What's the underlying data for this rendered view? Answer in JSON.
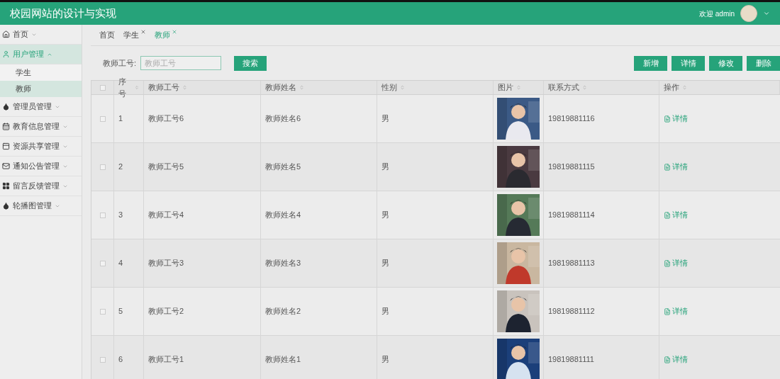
{
  "header": {
    "title": "校园网站的设计与实现",
    "welcome": "欢迎 admin"
  },
  "sidebar": {
    "items": [
      {
        "label": "首页",
        "expanded": false,
        "selected": false
      },
      {
        "label": "用户管理",
        "expanded": true,
        "selected": true,
        "children": [
          {
            "label": "学生",
            "selected": false
          },
          {
            "label": "教师",
            "selected": true
          }
        ]
      },
      {
        "label": "管理员管理",
        "expanded": false,
        "selected": false
      },
      {
        "label": "教育信息管理",
        "expanded": false,
        "selected": false
      },
      {
        "label": "资源共享管理",
        "expanded": false,
        "selected": false
      },
      {
        "label": "通知公告管理",
        "expanded": false,
        "selected": false
      },
      {
        "label": "留言反馈管理",
        "expanded": false,
        "selected": false
      },
      {
        "label": "轮播图管理",
        "expanded": false,
        "selected": false
      }
    ]
  },
  "tabs": [
    {
      "label": "首页",
      "closable": false,
      "selected": false
    },
    {
      "label": "学生",
      "closable": true,
      "selected": false
    },
    {
      "label": "教师",
      "closable": true,
      "selected": true
    }
  ],
  "search": {
    "label": "教师工号:",
    "placeholder": "教师工号",
    "button": "搜索"
  },
  "actions": [
    "新增",
    "详情",
    "修改",
    "删除"
  ],
  "table": {
    "all_checked": false,
    "columns": [
      "序号",
      "教师工号",
      "教师姓名",
      "性别",
      "图片",
      "联系方式",
      "操作"
    ],
    "rows": [
      {
        "no": "1",
        "id": "教师工号6",
        "name": "教师姓名6",
        "gender": "男",
        "phone": "19819881116",
        "action": "详情",
        "checked": false
      },
      {
        "no": "2",
        "id": "教师工号5",
        "name": "教师姓名5",
        "gender": "男",
        "phone": "19819881115",
        "action": "详情",
        "checked": false
      },
      {
        "no": "3",
        "id": "教师工号4",
        "name": "教师姓名4",
        "gender": "男",
        "phone": "19819881114",
        "action": "详情",
        "checked": false
      },
      {
        "no": "4",
        "id": "教师工号3",
        "name": "教师姓名3",
        "gender": "男",
        "phone": "19819881113",
        "action": "详情",
        "checked": false
      },
      {
        "no": "5",
        "id": "教师工号2",
        "name": "教师姓名2",
        "gender": "男",
        "phone": "19819881112",
        "action": "详情",
        "checked": false
      },
      {
        "no": "6",
        "id": "教师工号1",
        "name": "教师姓名1",
        "gender": "男",
        "phone": "19819881111",
        "action": "详情",
        "checked": false
      }
    ]
  }
}
